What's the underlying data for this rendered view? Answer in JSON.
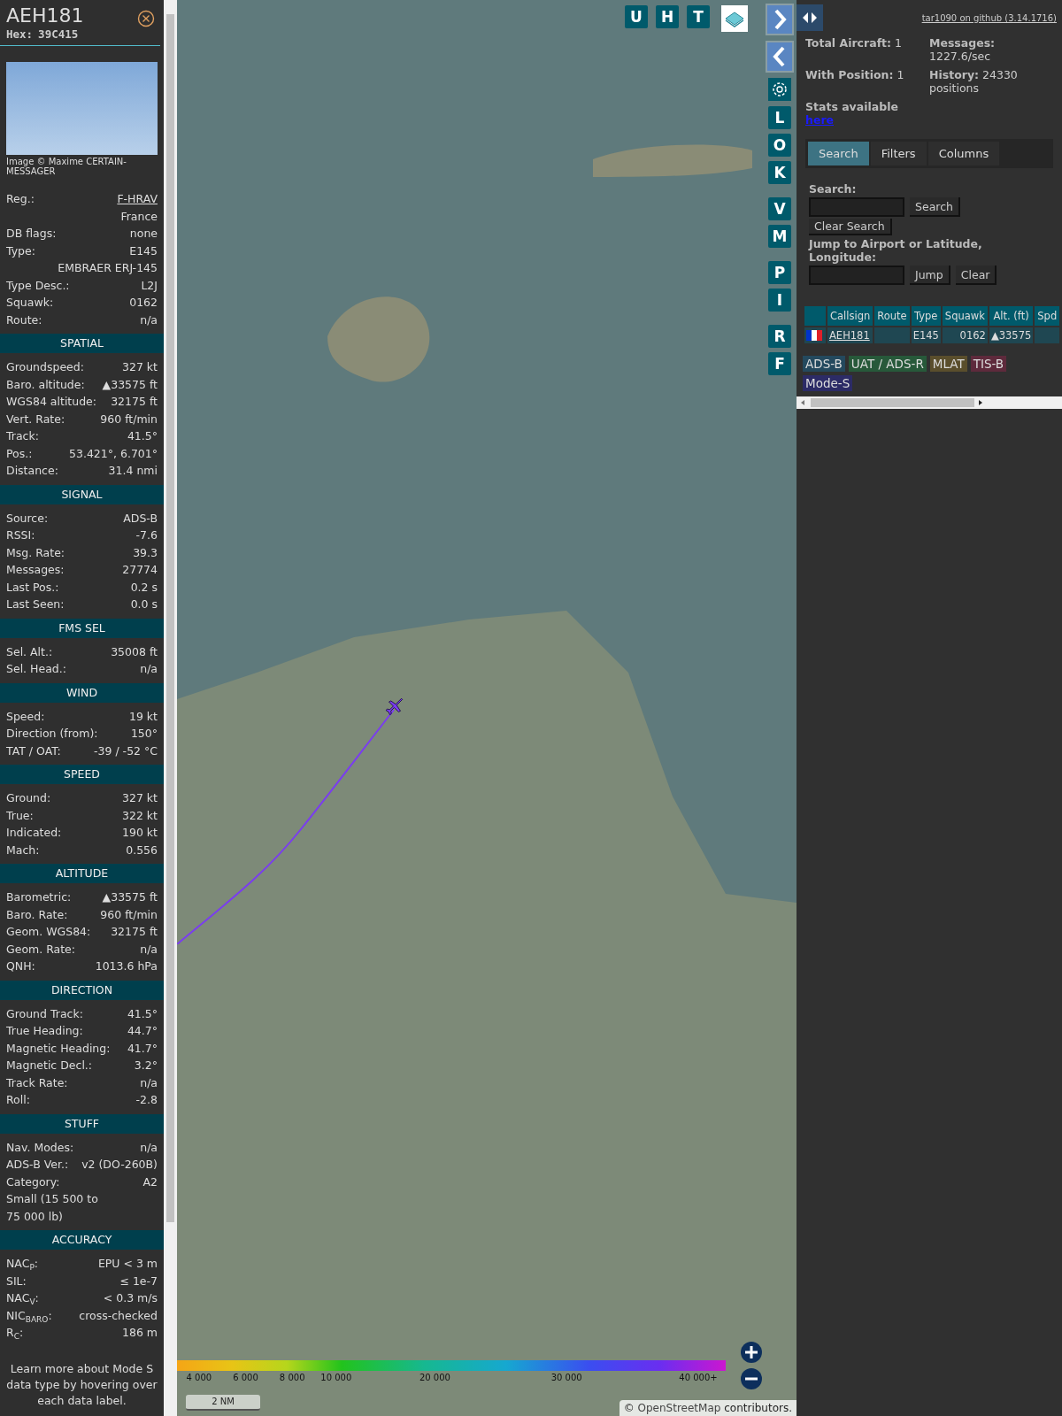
{
  "aircraft": {
    "callsign": "AEH181",
    "hex_label": "Hex:",
    "hex": "39C415",
    "photo_credit": "Image © Maxime CERTAIN-MESSAGER",
    "rows": [
      {
        "label": "Reg.:",
        "value": "F-HRAV",
        "link": true
      },
      {
        "value": "France",
        "link": false
      },
      {
        "label": "DB flags:",
        "value": "none",
        "link": false
      },
      {
        "label": "Type:",
        "value": "E145",
        "link": false
      },
      {
        "value": "EMBRAER ERJ-145",
        "link": false
      },
      {
        "label": "Type Desc.:",
        "value": "L2J",
        "link": false
      },
      {
        "label": "Squawk:",
        "value": "0162",
        "link": false
      },
      {
        "label": "Route:",
        "value": "n/a",
        "link": false
      }
    ]
  },
  "sections": [
    {
      "title": "SPATIAL",
      "rows": [
        {
          "label": "Groundspeed:",
          "value": "327 kt"
        },
        {
          "label": "Baro. altitude:",
          "value": "▲33575 ft"
        },
        {
          "label": "WGS84 altitude:",
          "value": "32175 ft"
        },
        {
          "label": "Vert. Rate:",
          "value": "960 ft/min"
        },
        {
          "label": "Track:",
          "value": "41.5°"
        },
        {
          "label": "Pos.:",
          "value": "53.421°, 6.701°"
        },
        {
          "label": "Distance:",
          "value": "31.4 nmi"
        }
      ]
    },
    {
      "title": "SIGNAL",
      "rows": [
        {
          "label": "Source:",
          "value": "ADS-B"
        },
        {
          "label": "RSSI:",
          "value": "-7.6"
        },
        {
          "label": "Msg. Rate:",
          "value": "39.3"
        },
        {
          "label": "Messages:",
          "value": "27774"
        },
        {
          "label": "Last Pos.:",
          "value": "0.2 s"
        },
        {
          "label": "Last Seen:",
          "value": "0.0 s"
        }
      ]
    },
    {
      "title": "FMS SEL",
      "rows": [
        {
          "label": "Sel. Alt.:",
          "value": "35008 ft"
        },
        {
          "label": "Sel. Head.:",
          "value": "n/a"
        }
      ]
    },
    {
      "title": "WIND",
      "rows": [
        {
          "label": "Speed:",
          "value": "19 kt"
        },
        {
          "label": "Direction (from):",
          "value": "150°"
        },
        {
          "label": "TAT / OAT:",
          "value": "-39 / -52 °C"
        }
      ]
    },
    {
      "title": "SPEED",
      "rows": [
        {
          "label": "Ground:",
          "value": "327 kt"
        },
        {
          "label": "True:",
          "value": "322 kt"
        },
        {
          "label": "Indicated:",
          "value": "190 kt"
        },
        {
          "label": "Mach:",
          "value": "0.556"
        }
      ]
    },
    {
      "title": "ALTITUDE",
      "rows": [
        {
          "label": "Barometric:",
          "value": "▲33575 ft"
        },
        {
          "label": "Baro. Rate:",
          "value": "960 ft/min"
        },
        {
          "label": "Geom. WGS84:",
          "value": "32175 ft"
        },
        {
          "label": "Geom. Rate:",
          "value": "n/a"
        },
        {
          "label": "QNH:",
          "value": "1013.6 hPa"
        }
      ]
    },
    {
      "title": "DIRECTION",
      "rows": [
        {
          "label": "Ground Track:",
          "value": "41.5°"
        },
        {
          "label": "True Heading:",
          "value": "44.7°"
        },
        {
          "label": "Magnetic Heading:",
          "value": "41.7°"
        },
        {
          "label": "Magnetic Decl.:",
          "value": "3.2°"
        },
        {
          "label": "Track Rate:",
          "value": "n/a"
        },
        {
          "label": "Roll:",
          "value": "-2.8"
        }
      ]
    },
    {
      "title": "STUFF",
      "rows": [
        {
          "label": "Nav. Modes:",
          "value": "n/a"
        },
        {
          "label": "ADS-B Ver.:",
          "value": "v2 (DO-260B)"
        },
        {
          "label": "Category:",
          "value": "A2"
        },
        {
          "label": "Small (15 500 to 75 000 lb)"
        }
      ]
    },
    {
      "title": "ACCURACY",
      "rows": [
        {
          "label": "NAC$_{P}$:",
          "value": "EPU < 3 m"
        },
        {
          "label": "SIL:",
          "value": "≤ 1e-7"
        },
        {
          "label": "NAC$_{V}$:",
          "value": "< 0.3 m/s"
        },
        {
          "label": "NIC$_{BARO}$:",
          "value": "cross-checked"
        },
        {
          "label": "R$_{C}$:",
          "value": "186 m"
        }
      ]
    }
  ],
  "footer_note": "Learn more about Mode S data type by hovering over each data label.",
  "map": {
    "top_buttons": [
      "U",
      "H",
      "T"
    ],
    "side_groups": [
      [
        "L",
        "O",
        "K"
      ],
      [
        "V",
        "M"
      ],
      [
        "P",
        "I"
      ],
      [
        "R",
        "F"
      ]
    ],
    "legend": [
      "4 000",
      "6 000",
      "8 000",
      "10 000",
      "20 000",
      "30 000",
      "40 000+"
    ],
    "scale": "2 NM",
    "attribution_prefix": "©",
    "attribution_link": "OpenStreetMap",
    "attribution_suffix": "contributors."
  },
  "panel": {
    "github_link": "tar1090 on github (3.14.1716)",
    "stats": [
      {
        "label": "Total Aircraft:",
        "value": "1"
      },
      {
        "label": "Messages:",
        "value": "1227.6/sec"
      },
      {
        "label": "With Position:",
        "value": "1"
      },
      {
        "label": "History:",
        "value": "24330 positions"
      }
    ],
    "stats_text": "Stats available",
    "stats_link": "here",
    "tabs": [
      {
        "label": "Search",
        "selected": true
      },
      {
        "label": "Filters",
        "selected": false
      },
      {
        "label": "Columns",
        "selected": false
      }
    ],
    "search_label": "Search:",
    "search_button": "Search",
    "clear_search_button": "Clear Search",
    "jump_label": "Jump to Airport or Latitude, Longitude:",
    "jump_button": "Jump",
    "clear_button": "Clear",
    "table": {
      "columns": [
        "",
        "Callsign",
        "Route",
        "Type",
        "Squawk",
        "Alt. (ft)",
        "Spd"
      ],
      "rows": [
        {
          "callsign": "AEH181",
          "route": "",
          "type": "E145",
          "squawk": "0162",
          "altitude": "▲33575"
        }
      ]
    },
    "tags": [
      {
        "label": "ADS-B",
        "color": "#24495e"
      },
      {
        "label": "UAT / ADS-R",
        "color": "#27593a"
      },
      {
        "label": "MLAT",
        "color": "#5a4e2c"
      },
      {
        "label": "TIS-B",
        "color": "#5e2a3c"
      },
      {
        "label": "Mode-S",
        "color": "#2c2b66"
      }
    ]
  }
}
